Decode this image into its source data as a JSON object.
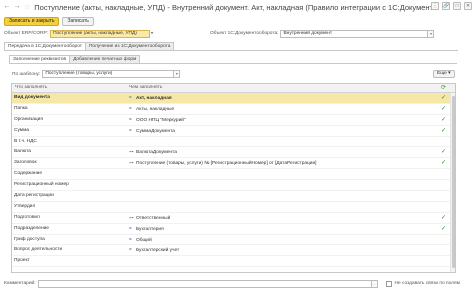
{
  "window": {
    "title": "Поступление (акты, накладные, УПД) - Внутренний документ. Акт, накладная (Правило интеграции с 1С:Документооборо",
    "nav_back": "←",
    "nav_fwd": "→",
    "star": "☆",
    "buttons": {
      "more": "⋮",
      "link": "🔗",
      "maximize": "□",
      "close": "✕"
    }
  },
  "toolbar": {
    "save_close": "Записать и закрыть",
    "save": "Записать"
  },
  "fields": {
    "erp_object_label": "Объект ERP/CORP:",
    "erp_object_value": "Поступление (акты, накладные, УПД)",
    "doc_object_label": "Объект 1С:Документооборота:",
    "doc_object_value": "Внутренний документ"
  },
  "tabs": [
    "Передача в 1С:Документооборот",
    "Получение из 1С:Документооборота"
  ],
  "subtabs": [
    "Заполнение реквизитов",
    "Добавление печатных форм"
  ],
  "template": {
    "label": "По шаблону:",
    "value": "Поступление (товары, услуги)",
    "more": "Еще"
  },
  "table": {
    "col1": "Что заполнять",
    "col2": "Чем заполнять",
    "refresh_icon": "⟳",
    "rows": [
      {
        "what": "Вид документа",
        "icon": "=",
        "with": "Акт, накладная",
        "check": "✓",
        "sel": true
      },
      {
        "what": "Папка",
        "icon": "=",
        "with": "Акты, накладные",
        "check": "✓"
      },
      {
        "what": "Организация",
        "icon": "=",
        "with": "ООО НПЦ \"Меркурий\"",
        "check": "✓"
      },
      {
        "what": "Сумма",
        "icon": "=",
        "with": "СуммаДокумента",
        "check": "✓"
      },
      {
        "what": "В т.ч. НДС",
        "icon": "",
        "with": "",
        "check": ""
      },
      {
        "what": "Валюта",
        "icon": "⊶",
        "with": "ВалютаДокумента",
        "check": "✓"
      },
      {
        "what": "Заголовок",
        "icon": "⊶",
        "with": "Поступление (товары, услуги) № [РегистрационныйНомер] от [ДатаРегистрации]",
        "check": "✓"
      },
      {
        "what": "Содержание",
        "icon": "",
        "with": "",
        "check": ""
      },
      {
        "what": "Регистрационный номер",
        "icon": "",
        "with": "",
        "check": ""
      },
      {
        "what": "Дата регистрации",
        "icon": "",
        "with": "",
        "check": ""
      },
      {
        "what": "Утвердил",
        "icon": "",
        "with": "",
        "check": ""
      },
      {
        "what": "Подготовил",
        "icon": "⊶",
        "with": "Ответственный",
        "check": "✓"
      },
      {
        "what": "Подразделение",
        "icon": "=",
        "with": "Бухгалтерия",
        "check": "✓"
      },
      {
        "what": "Гриф доступа",
        "icon": "=",
        "with": "Общий",
        "check": ""
      },
      {
        "what": "Вопрос деятельности",
        "icon": "=",
        "with": "Бухгалтерский учет",
        "check": ""
      },
      {
        "what": "Проект",
        "icon": "",
        "with": "",
        "check": ""
      }
    ]
  },
  "bottom": {
    "comment_label": "Комментарий:",
    "comment_value": "",
    "nocreate_label": "Не создавать связи по полям"
  }
}
